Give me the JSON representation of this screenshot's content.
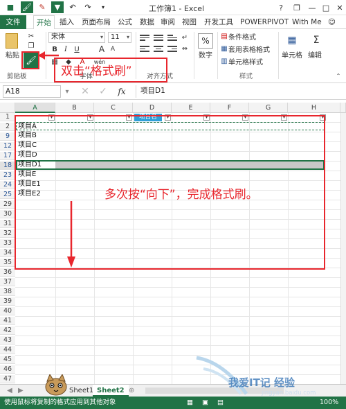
{
  "titlebar": {
    "title": "工作簿1 - Excel",
    "help_label": "?",
    "restore_label": "❐",
    "minimize_label": "—",
    "maximize_label": "□",
    "close_label": "✕"
  },
  "menu": {
    "file": "文件",
    "home": "开始",
    "insert": "插入",
    "page_layout": "页面布局",
    "formulas": "公式",
    "data": "数据",
    "review": "审阅",
    "view": "视图",
    "developer": "开发工具",
    "powerpivot": "POWERPIVOT",
    "account": "With Me"
  },
  "ribbon": {
    "paste_label": "粘贴",
    "clipboard_label": "剪贴板",
    "font_name": "宋体",
    "font_size": "11",
    "bold": "B",
    "italic": "I",
    "underline": "U",
    "font_grow": "A",
    "font_shrink": "A",
    "wen": "wén",
    "font_group": "字体",
    "align_group": "对齐方式",
    "number_symbol": "%",
    "number_label": "数字",
    "cond_format": "条件格式",
    "table_format": "套用表格格式",
    "cell_style": "单元格样式",
    "styles_group": "样式",
    "cells_label": "单元格",
    "edit_label": "编辑"
  },
  "formula": {
    "namebox": "A18",
    "content": "项目D1",
    "fx": "fx"
  },
  "grid": {
    "columns": [
      "A",
      "B",
      "C",
      "D",
      "E",
      "F",
      "G",
      "H"
    ],
    "row_numbers": [
      "1",
      "2",
      "9",
      "12",
      "17",
      "18",
      "23",
      "24",
      "25",
      "29",
      "30",
      "31",
      "32",
      "33",
      "34",
      "35",
      "36",
      "37",
      "38",
      "39",
      "40",
      "41",
      "42",
      "43",
      "44",
      "45",
      "46",
      "47"
    ],
    "cells": [
      "项目A",
      "项目B",
      "项目C",
      "项目D",
      "项目D1",
      "项目E",
      "项目E1",
      "项目E2"
    ],
    "header_fragment": "项目名"
  },
  "sheets": [
    "Sheet1",
    "Sheet2"
  ],
  "status": "使用鼠标将复制的格式应用到其他对象",
  "status_zoom": "100%",
  "annotations": {
    "double_click": "双击“格式刷”",
    "repeat_down": "多次按“向下”，完成格式刷。"
  },
  "watermark": {
    "text": "我爱IT记 经验",
    "url": "jingyan.baidu.com"
  },
  "colors": {
    "accent": "#217346",
    "annotation": "#e8262d"
  }
}
